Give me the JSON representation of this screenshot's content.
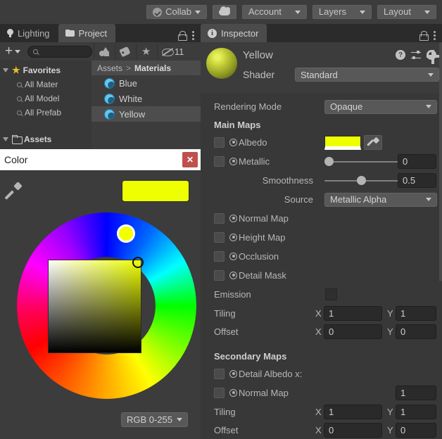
{
  "toolbar": {
    "collab_label": "Collab",
    "collab_icon": "check-circle-icon",
    "cloud_icon": "cloud-icon",
    "account_label": "Account",
    "layers_label": "Layers",
    "layout_label": "Layout"
  },
  "left_tabs": {
    "lighting_label": "Lighting",
    "lighting_icon": "lightbulb-icon",
    "project_label": "Project",
    "project_icon": "folder-icon",
    "lock_icon": "lock-icon",
    "menu_icon": "kebab-menu-icon"
  },
  "right_tabs": {
    "inspector_label": "Inspector",
    "inspector_icon": "info-icon",
    "lock_icon": "lock-icon",
    "menu_icon": "kebab-menu-icon"
  },
  "project": {
    "create_label": "+",
    "search_placeholder": "",
    "search_value": "",
    "search_icon": "search-icon",
    "filter_shapes_icon": "shapes-filter-icon",
    "filter_tag_icon": "tag-filter-icon",
    "filter_star_icon": "star-filter-icon",
    "hidden_icon": "eye-off-icon",
    "hidden_count": "11",
    "tree": [
      {
        "label": "Favorites",
        "icon": "star-icon",
        "bold": true,
        "indent": false
      },
      {
        "label": "All Mater",
        "icon": "search-icon",
        "bold": false,
        "indent": true
      },
      {
        "label": "All Model",
        "icon": "search-icon",
        "bold": false,
        "indent": true
      },
      {
        "label": "All Prefab",
        "icon": "search-icon",
        "bold": false,
        "indent": true
      },
      {
        "label": "Assets",
        "icon": "folder-icon",
        "bold": true,
        "indent": false
      }
    ],
    "breadcrumb": {
      "root": "Assets",
      "separator": ">",
      "current": "Materials"
    },
    "assets": [
      {
        "name": "Blue",
        "icon": "material-ball-icon",
        "selected": false
      },
      {
        "name": "White",
        "icon": "material-ball-icon",
        "selected": false
      },
      {
        "name": "Yellow",
        "icon": "material-ball-icon",
        "selected": true
      }
    ]
  },
  "color_window": {
    "title": "Color",
    "close_label": "✕",
    "eyedropper_icon": "eyedropper-icon",
    "current_color": "#EEFF00",
    "wheel_hue_color": "#F2FF00",
    "mode_label": "RGB 0-255"
  },
  "inspector": {
    "material_name": "Yellow",
    "help_icon": "help-icon",
    "preset_icon": "preset-icon",
    "settings_icon": "gear-icon",
    "shader_label": "Shader",
    "shader_value": "Standard",
    "rendering_mode_label": "Rendering Mode",
    "rendering_mode_value": "Opaque",
    "main_maps_header": "Main Maps",
    "albedo_label": "Albedo",
    "albedo_color": "#EEFF00",
    "albedo_picker_icon": "eyedropper-icon",
    "metallic_label": "Metallic",
    "metallic_value": "0",
    "smoothness_label": "Smoothness",
    "smoothness_value": "0.5",
    "source_label": "Source",
    "source_value": "Metallic Alpha",
    "normal_map_label": "Normal Map",
    "height_map_label": "Height Map",
    "occlusion_label": "Occlusion",
    "detail_mask_label": "Detail Mask",
    "emission_label": "Emission",
    "emission_color": "#2F2F2F",
    "tiling_label": "Tiling",
    "tiling_x": "1",
    "tiling_y": "1",
    "offset_label": "Offset",
    "offset_x": "0",
    "offset_y": "0",
    "secondary_maps_header": "Secondary Maps",
    "detail_albedo_label": "Detail Albedo x:",
    "secondary_normal_label": "Normal Map",
    "secondary_normal_value": "1",
    "secondary_tiling_label": "Tiling",
    "secondary_tiling_x": "1",
    "secondary_tiling_y": "1",
    "secondary_offset_label": "Offset",
    "secondary_offset_x": "0",
    "secondary_offset_y": "0",
    "axis_x": "X",
    "axis_y": "Y"
  }
}
